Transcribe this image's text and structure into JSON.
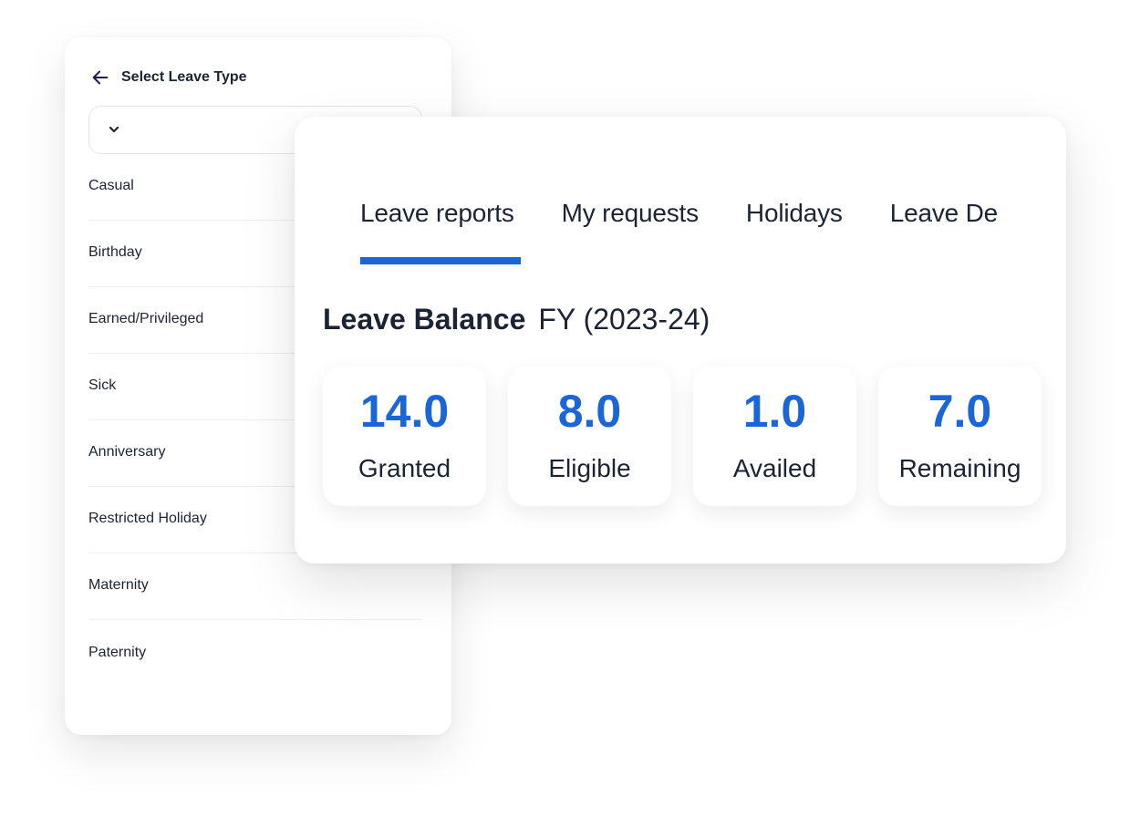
{
  "left_panel": {
    "title": "Select Leave Type",
    "select": {
      "value": ""
    },
    "leave_types": [
      "Casual",
      "Birthday",
      "Earned/Privileged",
      "Sick",
      "Anniversary",
      "Restricted Holiday",
      "Maternity",
      "Paternity"
    ]
  },
  "right_panel": {
    "tabs": [
      {
        "label": "Leave reports",
        "active": true
      },
      {
        "label": "My requests",
        "active": false
      },
      {
        "label": "Holidays",
        "active": false
      },
      {
        "label": "Leave De",
        "active": false
      }
    ],
    "balance_title": "Leave Balance",
    "fiscal_year": "FY (2023-24)",
    "cards": [
      {
        "value": "14.0",
        "label": "Granted"
      },
      {
        "value": "8.0",
        "label": "Eligible"
      },
      {
        "value": "1.0",
        "label": "Availed"
      },
      {
        "value": "7.0",
        "label": "Remaining"
      }
    ]
  },
  "colors": {
    "accent": "#1a66d9",
    "text": "#1c2434"
  }
}
